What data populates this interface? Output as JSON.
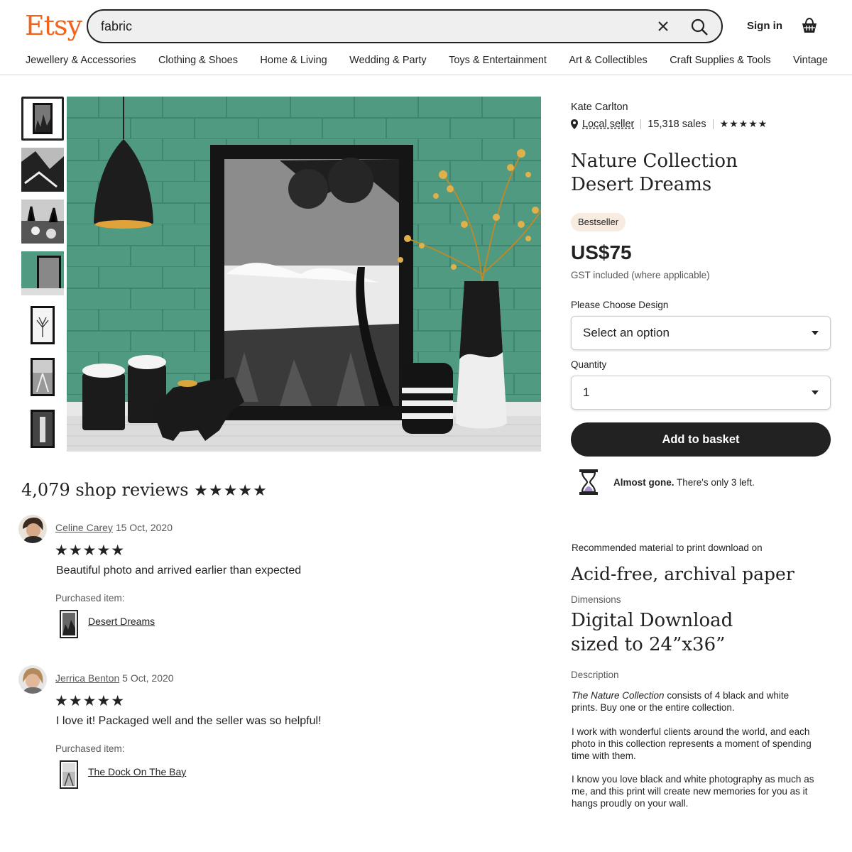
{
  "header": {
    "logo": "Etsy",
    "search_value": "fabric",
    "signin_label": "Sign in",
    "nav": [
      "Jewellery & Accessories",
      "Clothing & Shoes",
      "Home & Living",
      "Wedding & Party",
      "Toys & Entertainment",
      "Art & Collectibles",
      "Craft Supplies & Tools",
      "Vintage"
    ]
  },
  "product": {
    "shop_name": "Kate Carlton",
    "local_seller": "Local seller",
    "sales": "15,318 sales",
    "shop_stars": "★★★★★",
    "title_line1": "Nature Collection",
    "title_line2": "Desert Dreams",
    "badge": "Bestseller",
    "price": "US$75",
    "gst_note": "GST included (where applicable)",
    "design_label": "Please Choose Design",
    "design_value": "Select an option",
    "quantity_label": "Quantity",
    "quantity_value": "1",
    "add_button": "Add to basket",
    "almost_gone_bold": "Almost gone.",
    "almost_gone_rest": " There's only 3 left.",
    "recommended_label": "Recommended material to print download on",
    "recommended_value": "Acid-free, archival paper",
    "dimensions_label": "Dimensions",
    "dimensions_line1": "Digital Download",
    "dimensions_line2": "sized to 24”x36”",
    "description_label": "Description",
    "description_p1_italic": "The Nature Collection",
    "description_p1_rest": " consists of 4 black and white prints. Buy one or the entire collection.",
    "description_p2": "I work with wonderful clients around the world, and each photo in this collection represents a moment of spending time with them.",
    "description_p3": "I know you love black and white photography as much as me, and this print will create new memories for you as it hangs proudly on your wall."
  },
  "reviews": {
    "title": "4,079 shop reviews",
    "title_stars": "★★★★★",
    "items": [
      {
        "name": "Celine Carey",
        "date": "15 Oct, 2020",
        "stars": "★★★★★",
        "text": "Beautiful photo and arrived earlier than expected",
        "purchased_label": "Purchased item:",
        "item": "Desert Dreams"
      },
      {
        "name": "Jerrica Benton",
        "date": "5 Oct, 2020",
        "stars": "★★★★★",
        "text": "I love it! Packaged well and the seller was so helpful!",
        "purchased_label": "Purchased item:",
        "item": "The Dock On The Bay"
      }
    ]
  },
  "colors": {
    "brand": "#f1641e",
    "wall": "#4f9a80",
    "button": "#222222",
    "badge_bg": "#f8ebdf"
  }
}
